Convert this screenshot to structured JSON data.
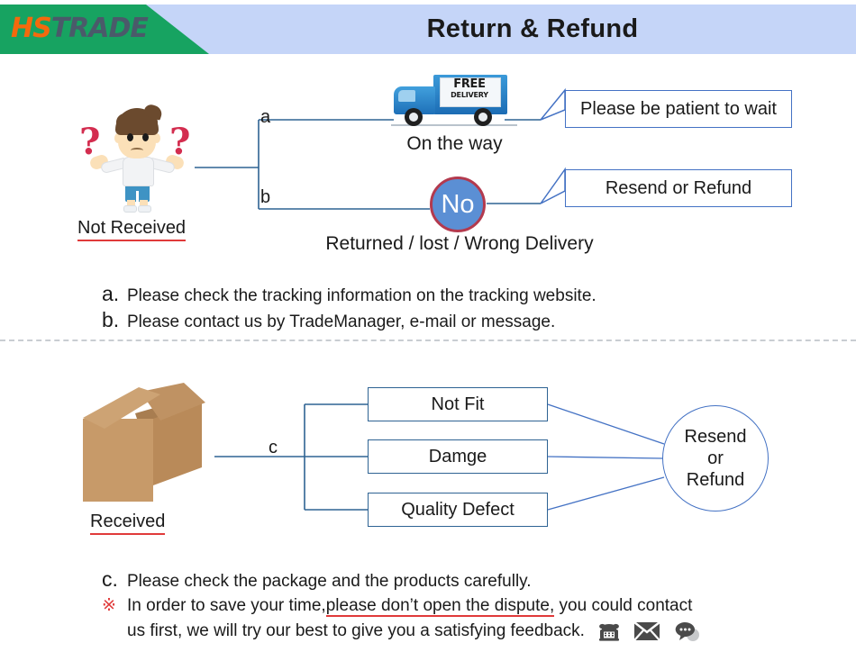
{
  "header": {
    "logo_hs": "HS",
    "logo_trade": "TRADE",
    "title": "Return & Refund"
  },
  "colors": {
    "header_bg": "#c5d5f8",
    "logo_green": "#17a361",
    "logo_orange": "#f4690d",
    "logo_gray": "#4a5a6a",
    "wire_blue": "#2e6393",
    "callout_blue": "#4472c4",
    "accent_red": "#e03a3a",
    "no_circle_fill": "#5b8fd4",
    "no_circle_border": "#b33a4e",
    "carton_brown": "#c79a69",
    "icon_gray": "#4a4a4a"
  },
  "section_not_received": {
    "person_label": "Not Received",
    "branch_a": "a",
    "branch_b": "b",
    "truck_free": "FREE",
    "truck_delivery": "DELIVERY",
    "truck_caption": "On the way",
    "no_circle_label": "No",
    "no_caption": "Returned / lost / Wrong Delivery",
    "callout_a": "Please be patient to wait",
    "callout_b": "Resend or Refund",
    "instructions": [
      {
        "marker": "a.",
        "text": "Please check the tracking information on the tracking website."
      },
      {
        "marker": "b.",
        "text": "Please contact us by TradeManager, e-mail or message."
      }
    ]
  },
  "section_received": {
    "box_label": "Received",
    "branch_c": "c",
    "options": [
      {
        "label": "Not Fit"
      },
      {
        "label": "Damge"
      },
      {
        "label": "Quality Defect"
      }
    ],
    "result_lines": [
      "Resend",
      "or",
      "Refund"
    ],
    "instructions": [
      {
        "marker": "c.",
        "text": "Please check the package and the products carefully."
      }
    ],
    "note": {
      "marker": "※",
      "text_before": "In order to save your time,",
      "text_underlined": "please don’t open the dispute,",
      "text_after": " you could  contact",
      "text_line2": "us first, we will try our best to give you a satisfying feedback."
    },
    "contact_icons": [
      "telephone-icon",
      "envelope-icon",
      "chat-bubble-icon"
    ]
  }
}
